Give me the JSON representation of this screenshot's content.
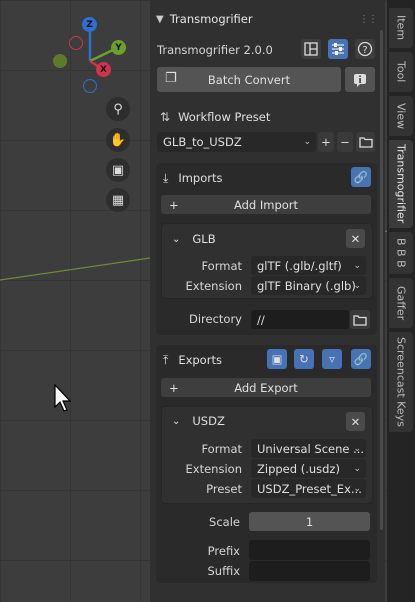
{
  "panel": {
    "header_title": "Transmogrifier",
    "addon_title": "Transmogrifier 2.0.0",
    "batch_convert_label": "Batch Convert",
    "workflow_preset_label": "Workflow Preset",
    "workflow_preset_value": "GLB_to_USDZ",
    "imports": {
      "title": "Imports",
      "add_label": "Add Import",
      "item": {
        "name": "GLB",
        "format_label": "Format",
        "format_value": "glTF (.glb/.gltf)",
        "extension_label": "Extension",
        "extension_value": "glTF Binary (.glb)",
        "directory_label": "Directory",
        "directory_value": "//"
      }
    },
    "exports": {
      "title": "Exports",
      "add_label": "Add Export",
      "item": {
        "name": "USDZ",
        "format_label": "Format",
        "format_value": "Universal Scene ...",
        "extension_label": "Extension",
        "extension_value": "Zipped (.usdz)",
        "preset_label": "Preset",
        "preset_value": "USDZ_Preset_Ex...",
        "scale_label": "Scale",
        "scale_value": "1",
        "prefix_label": "Prefix",
        "prefix_value": "",
        "suffix_label": "Suffix",
        "suffix_value": ""
      }
    }
  },
  "gizmo": {
    "z": "Z",
    "y": "Y",
    "x": "X"
  },
  "sidebar_tabs": [
    "Item",
    "Tool",
    "View",
    "Transmogrifier",
    "B B B",
    "Gaffer",
    "Screencast Keys"
  ],
  "colors": {
    "accent": "#4772b3",
    "panel_bg": "#303030",
    "viewport_bg": "#3d3d3d"
  }
}
